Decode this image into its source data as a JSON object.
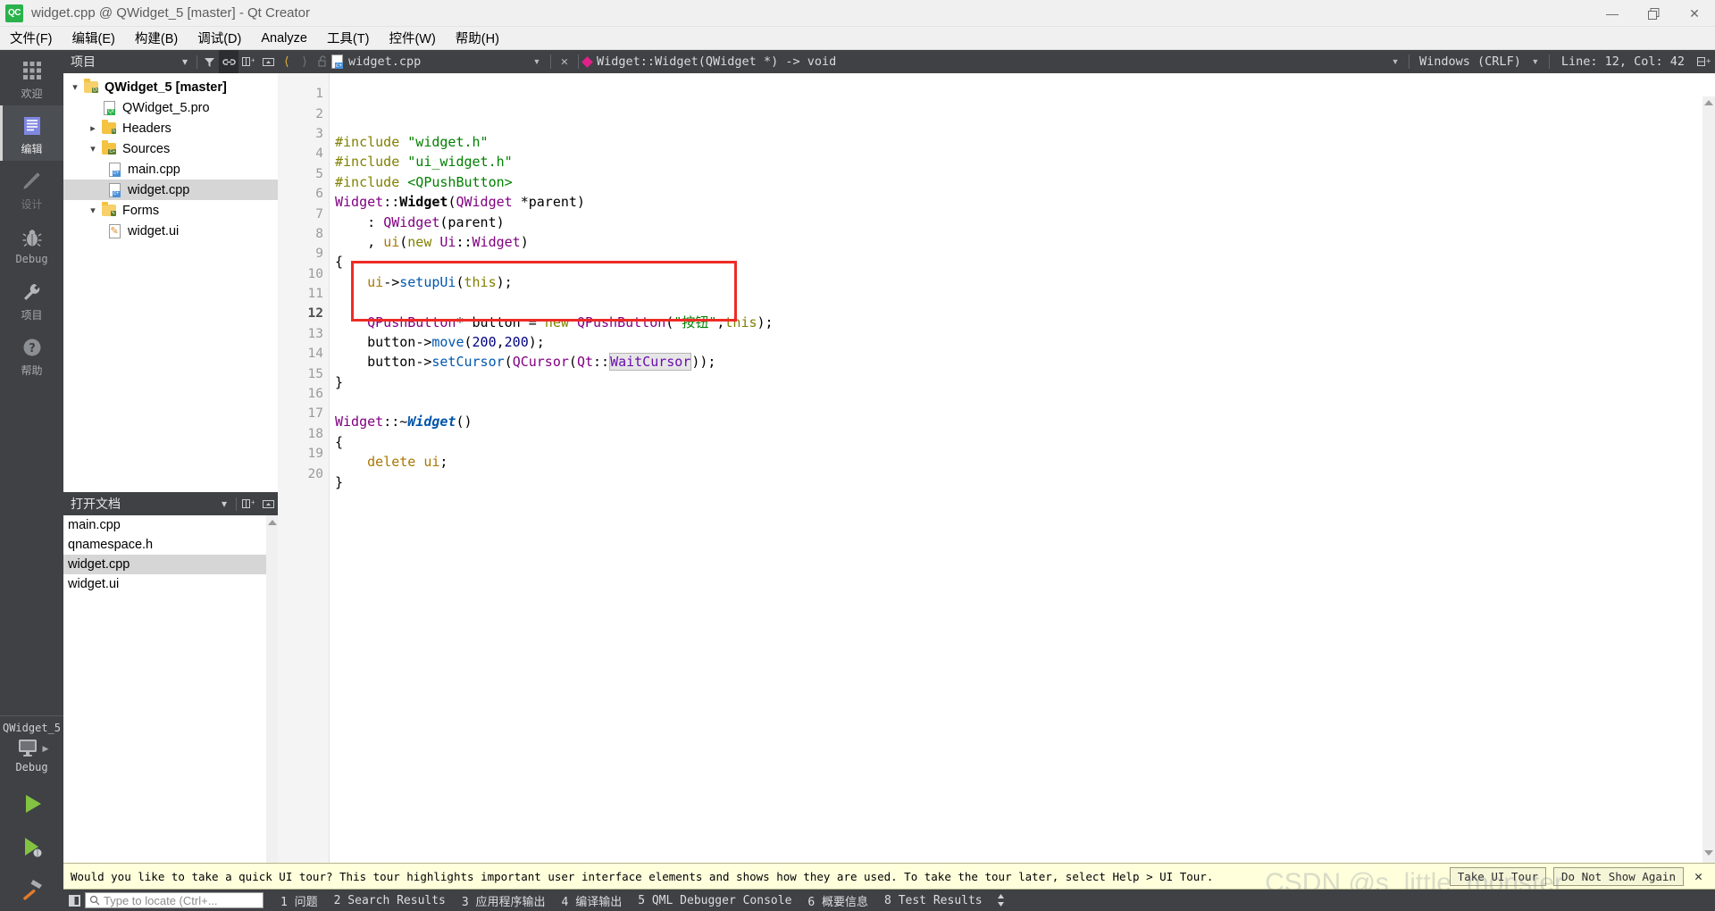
{
  "window": {
    "title": "widget.cpp @ QWidget_5 [master] - Qt Creator",
    "logo_text": "QC",
    "minimize_icon": "—",
    "restore_icon": "❐",
    "close_icon": "✕"
  },
  "menubar": {
    "items": [
      {
        "label": "文件(F)",
        "name": "menu-file"
      },
      {
        "label": "编辑(E)",
        "name": "menu-edit"
      },
      {
        "label": "构建(B)",
        "name": "menu-build"
      },
      {
        "label": "调试(D)",
        "name": "menu-debug"
      },
      {
        "label": "Analyze",
        "name": "menu-analyze"
      },
      {
        "label": "工具(T)",
        "name": "menu-tools"
      },
      {
        "label": "控件(W)",
        "name": "menu-window"
      },
      {
        "label": "帮助(H)",
        "name": "menu-help"
      }
    ]
  },
  "modebar": {
    "items": [
      {
        "label": "欢迎",
        "icon": "grid-icon",
        "active": false,
        "dim": false
      },
      {
        "label": "编辑",
        "icon": "document-icon",
        "active": true,
        "dim": false
      },
      {
        "label": "设计",
        "icon": "pencil-icon",
        "active": false,
        "dim": true
      },
      {
        "label": "Debug",
        "icon": "bug-icon",
        "active": false,
        "dim": false
      },
      {
        "label": "项目",
        "icon": "wrench-icon",
        "active": false,
        "dim": false
      },
      {
        "label": "帮助",
        "icon": "question-icon",
        "active": false,
        "dim": false
      }
    ],
    "kit": {
      "project": "QWidget_5",
      "config": "Debug",
      "target_icon": "monitor-icon"
    },
    "run_buttons": [
      {
        "name": "run-button",
        "icon": "play-icon"
      },
      {
        "name": "debug-button",
        "icon": "play-bug-icon"
      },
      {
        "name": "build-button",
        "icon": "hammer-icon"
      }
    ]
  },
  "project_panel": {
    "title": "项目",
    "header_icons": [
      "chevron-down-icon",
      "filter-icon",
      "link-icon",
      "split-icon",
      "close-panel-icon"
    ],
    "tree": [
      {
        "depth": 0,
        "twisty": "down",
        "icon": "project-folder-icon",
        "label": "QWidget_5 [master]",
        "bold": true,
        "selected": false
      },
      {
        "depth": 1,
        "twisty": "",
        "icon": "pro-file-icon",
        "label": "QWidget_5.pro",
        "bold": false,
        "selected": false
      },
      {
        "depth": 1,
        "twisty": "right",
        "icon": "headers-folder-icon",
        "label": "Headers",
        "bold": false,
        "selected": false
      },
      {
        "depth": 1,
        "twisty": "down",
        "icon": "sources-folder-icon",
        "label": "Sources",
        "bold": false,
        "selected": false
      },
      {
        "depth": 2,
        "twisty": "",
        "icon": "cpp-file-icon",
        "label": "main.cpp",
        "bold": false,
        "selected": false
      },
      {
        "depth": 2,
        "twisty": "",
        "icon": "cpp-file-icon",
        "label": "widget.cpp",
        "bold": false,
        "selected": true
      },
      {
        "depth": 1,
        "twisty": "down",
        "icon": "forms-folder-icon",
        "label": "Forms",
        "bold": false,
        "selected": false
      },
      {
        "depth": 2,
        "twisty": "",
        "icon": "ui-file-icon",
        "label": "widget.ui",
        "bold": false,
        "selected": false
      }
    ]
  },
  "open_documents": {
    "title": "打开文档",
    "header_icons": [
      "chevron-down-icon",
      "split-icon",
      "close-panel-icon"
    ],
    "items": [
      {
        "label": "main.cpp",
        "selected": false
      },
      {
        "label": "qnamespace.h",
        "selected": false
      },
      {
        "label": "widget.cpp",
        "selected": true
      },
      {
        "label": "widget.ui",
        "selected": false
      }
    ]
  },
  "editor_toolbar": {
    "back_icon": "chevron-left-icon",
    "forward_icon": "chevron-right-icon",
    "lock_icon": "unlock-icon",
    "file_icon": "cpp-file-icon",
    "filename": "widget.cpp",
    "file_dropdown_icon": "chevron-down-icon",
    "close_icon": "close-icon",
    "symbol_marker": "diamond-icon",
    "symbol": "Widget::Widget(QWidget *) -> void",
    "symbol_dropdown_icon": "chevron-down-icon",
    "line_ending": "Windows (CRLF)",
    "line_ending_dropdown_icon": "chevron-down-icon",
    "cursor_position": "Line: 12, Col: 42",
    "split_icon": "split-editor-icon"
  },
  "code": {
    "current_line": 12,
    "line_numbers": [
      "1",
      "2",
      "3",
      "4",
      "5",
      "6",
      "7",
      "8",
      "9",
      "10",
      "11",
      "12",
      "13",
      "14",
      "15",
      "16",
      "17",
      "18",
      "19",
      "20"
    ],
    "fold_lines": [
      6,
      15
    ],
    "lines": [
      {
        "n": 1,
        "tokens": [
          {
            "t": "#include ",
            "c": "tk-pre"
          },
          {
            "t": "\"widget.h\"",
            "c": "tk-str"
          }
        ]
      },
      {
        "n": 2,
        "tokens": [
          {
            "t": "#include ",
            "c": "tk-pre"
          },
          {
            "t": "\"ui_widget.h\"",
            "c": "tk-str"
          }
        ]
      },
      {
        "n": 3,
        "tokens": [
          {
            "t": "#include ",
            "c": "tk-pre"
          },
          {
            "t": "<QPushButton>",
            "c": "tk-str"
          }
        ]
      },
      {
        "n": 4,
        "tokens": [
          {
            "t": "Widget",
            "c": "tk-type"
          },
          {
            "t": "::",
            "c": "tk-txt"
          },
          {
            "t": "Widget",
            "c": "tk-fn"
          },
          {
            "t": "(",
            "c": "tk-txt"
          },
          {
            "t": "QWidget",
            "c": "tk-type"
          },
          {
            "t": " *parent)",
            "c": "tk-txt"
          }
        ]
      },
      {
        "n": 5,
        "tokens": [
          {
            "t": "    : ",
            "c": "tk-txt"
          },
          {
            "t": "QWidget",
            "c": "tk-type"
          },
          {
            "t": "(parent)",
            "c": "tk-txt"
          }
        ]
      },
      {
        "n": 6,
        "tokens": [
          {
            "t": "    , ",
            "c": "tk-txt"
          },
          {
            "t": "ui",
            "c": "tk-var"
          },
          {
            "t": "(",
            "c": "tk-txt"
          },
          {
            "t": "new",
            "c": "tk-kw"
          },
          {
            "t": " ",
            "c": "tk-txt"
          },
          {
            "t": "Ui",
            "c": "tk-type"
          },
          {
            "t": "::",
            "c": "tk-txt"
          },
          {
            "t": "Widget",
            "c": "tk-type"
          },
          {
            "t": ")",
            "c": "tk-txt"
          }
        ]
      },
      {
        "n": 7,
        "tokens": [
          {
            "t": "{",
            "c": "tk-txt"
          }
        ]
      },
      {
        "n": 8,
        "tokens": [
          {
            "t": "    ",
            "c": "tk-txt"
          },
          {
            "t": "ui",
            "c": "tk-var"
          },
          {
            "t": "->",
            "c": "tk-txt"
          },
          {
            "t": "setupUi",
            "c": "tk-blue"
          },
          {
            "t": "(",
            "c": "tk-txt"
          },
          {
            "t": "this",
            "c": "tk-kw"
          },
          {
            "t": ");",
            "c": "tk-txt"
          }
        ]
      },
      {
        "n": 9,
        "tokens": []
      },
      {
        "n": 10,
        "tokens": [
          {
            "t": "    ",
            "c": "tk-txt"
          },
          {
            "t": "QPushButton",
            "c": "tk-type"
          },
          {
            "t": "* button = ",
            "c": "tk-txt"
          },
          {
            "t": "new",
            "c": "tk-kw"
          },
          {
            "t": " ",
            "c": "tk-txt"
          },
          {
            "t": "QPushButton",
            "c": "tk-type"
          },
          {
            "t": "(",
            "c": "tk-txt"
          },
          {
            "t": "\"按钮\"",
            "c": "tk-str"
          },
          {
            "t": ",",
            "c": "tk-txt"
          },
          {
            "t": "this",
            "c": "tk-kw"
          },
          {
            "t": ");",
            "c": "tk-txt"
          }
        ]
      },
      {
        "n": 11,
        "tokens": [
          {
            "t": "    button",
            "c": "tk-txt"
          },
          {
            "t": "->",
            "c": "tk-txt"
          },
          {
            "t": "move",
            "c": "tk-blue"
          },
          {
            "t": "(",
            "c": "tk-txt"
          },
          {
            "t": "200",
            "c": "tk-num"
          },
          {
            "t": ",",
            "c": "tk-txt"
          },
          {
            "t": "200",
            "c": "tk-num"
          },
          {
            "t": ");",
            "c": "tk-txt"
          }
        ]
      },
      {
        "n": 12,
        "tokens": [
          {
            "t": "    button",
            "c": "tk-txt"
          },
          {
            "t": "->",
            "c": "tk-txt"
          },
          {
            "t": "setCursor",
            "c": "tk-blue"
          },
          {
            "t": "(",
            "c": "tk-txt"
          },
          {
            "t": "QCursor",
            "c": "tk-type"
          },
          {
            "t": "(",
            "c": "tk-txt"
          },
          {
            "t": "Qt",
            "c": "tk-type"
          },
          {
            "t": "::",
            "c": "tk-txt"
          },
          {
            "t": "WaitCursor",
            "c": "tk-occ"
          },
          {
            "t": "));",
            "c": "tk-txt"
          }
        ]
      },
      {
        "n": 13,
        "tokens": [
          {
            "t": "}",
            "c": "tk-txt"
          }
        ]
      },
      {
        "n": 14,
        "tokens": []
      },
      {
        "n": 15,
        "tokens": [
          {
            "t": "Widget",
            "c": "tk-type"
          },
          {
            "t": "::~",
            "c": "tk-txt"
          },
          {
            "t": "Widget",
            "c": "tk-fni"
          },
          {
            "t": "()",
            "c": "tk-txt"
          }
        ]
      },
      {
        "n": 16,
        "tokens": [
          {
            "t": "{",
            "c": "tk-txt"
          }
        ]
      },
      {
        "n": 17,
        "tokens": [
          {
            "t": "    ",
            "c": "tk-txt"
          },
          {
            "t": "delete",
            "c": "tk-var"
          },
          {
            "t": " ",
            "c": "tk-txt"
          },
          {
            "t": "ui",
            "c": "tk-var"
          },
          {
            "t": ";",
            "c": "tk-txt"
          }
        ]
      },
      {
        "n": 18,
        "tokens": [
          {
            "t": "}",
            "c": "tk-txt"
          }
        ]
      },
      {
        "n": 19,
        "tokens": []
      },
      {
        "n": 20,
        "tokens": []
      }
    ]
  },
  "tour": {
    "message": "Would you like to take a quick UI tour? This tour highlights important user interface elements and shows how they are used. To take the tour later, select Help > UI Tour.",
    "take_tour_label": "Take UI Tour",
    "dismiss_label": "Do Not Show Again",
    "close_icon": "✕"
  },
  "statusbar": {
    "toggle_sidebar_icon": "toggle-sidebar-icon",
    "locator_placeholder": "Type to locate (Ctrl+...",
    "locator_icon": "search-icon",
    "outputs": [
      "1 问题",
      "2 Search Results",
      "3 应用程序输出",
      "4 编译输出",
      "5 QML Debugger Console",
      "6 概要信息",
      "8 Test Results"
    ],
    "stepper_icon": "up-down-arrows-icon"
  },
  "watermark": {
    "line1": "CSDN @s_little_monster"
  },
  "colors": {
    "accent_green": "#2ab24c",
    "dark_chrome": "#3f4145",
    "highlight_box": "#ee2b26",
    "selection": "#d6d6d6",
    "notification_bg": "#ffffdc"
  }
}
